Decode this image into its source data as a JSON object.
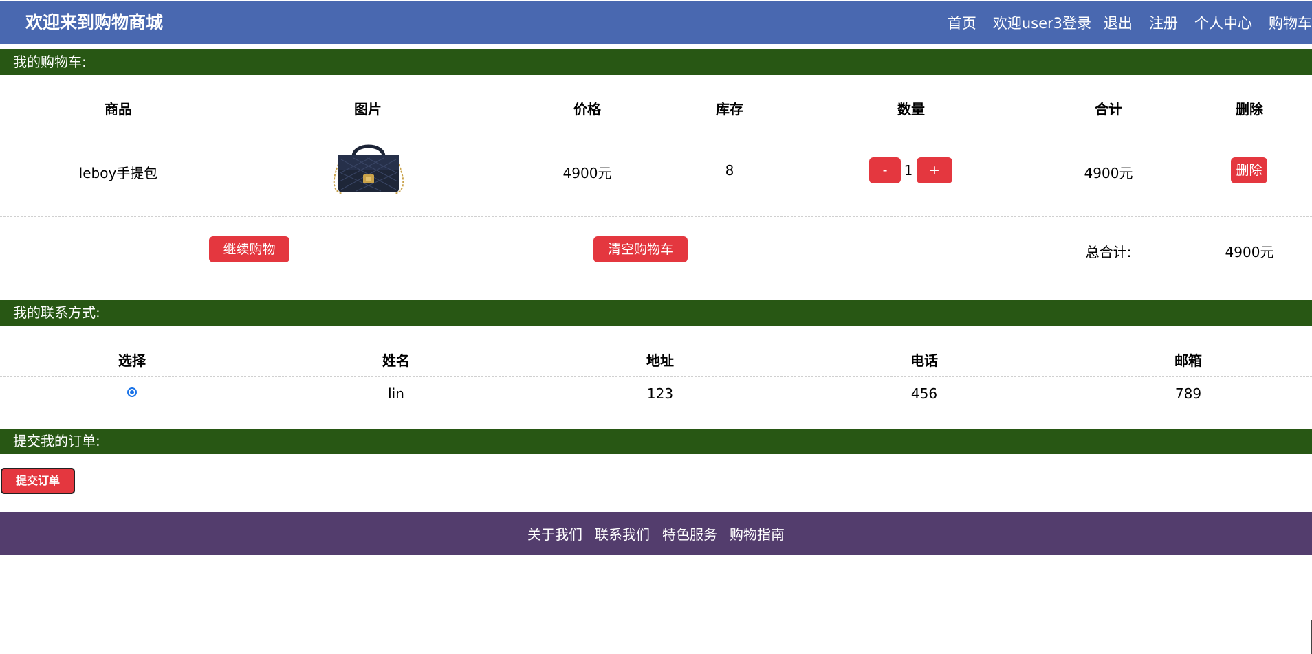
{
  "header": {
    "title": "欢迎来到购物商城",
    "nav": [
      "首页",
      "欢迎user3登录",
      "退出",
      "注册",
      "个人中心",
      "购物车"
    ]
  },
  "cart": {
    "section_title": "我的购物车:",
    "columns": [
      "商品",
      "图片",
      "价格",
      "库存",
      "数量",
      "合计",
      "删除"
    ],
    "items": [
      {
        "name": "leboy手提包",
        "image_icon": "handbag-image",
        "price": "4900元",
        "stock": "8",
        "qty_minus": "-",
        "quantity": "1",
        "qty_plus": "+",
        "subtotal": "4900元",
        "delete_label": "删除"
      }
    ],
    "continue_label": "继续购物",
    "clear_label": "清空购物车",
    "total_label": "总合计:",
    "total_value": "4900元"
  },
  "contact": {
    "section_title": "我的联系方式:",
    "columns": [
      "选择",
      "姓名",
      "地址",
      "电话",
      "邮箱"
    ],
    "rows": [
      {
        "selected": true,
        "name": "lin",
        "address": "123",
        "phone": "456",
        "email": "789"
      }
    ]
  },
  "order": {
    "section_title": "提交我的订单:",
    "submit_label": "提交订单"
  },
  "footer": {
    "links": [
      "关于我们",
      "联系我们",
      "特色服务",
      "购物指南"
    ]
  },
  "colors": {
    "header_bg": "#4968b0",
    "section_bg": "#285714",
    "button_red": "#e4373f",
    "footer_bg": "#533d6d"
  }
}
